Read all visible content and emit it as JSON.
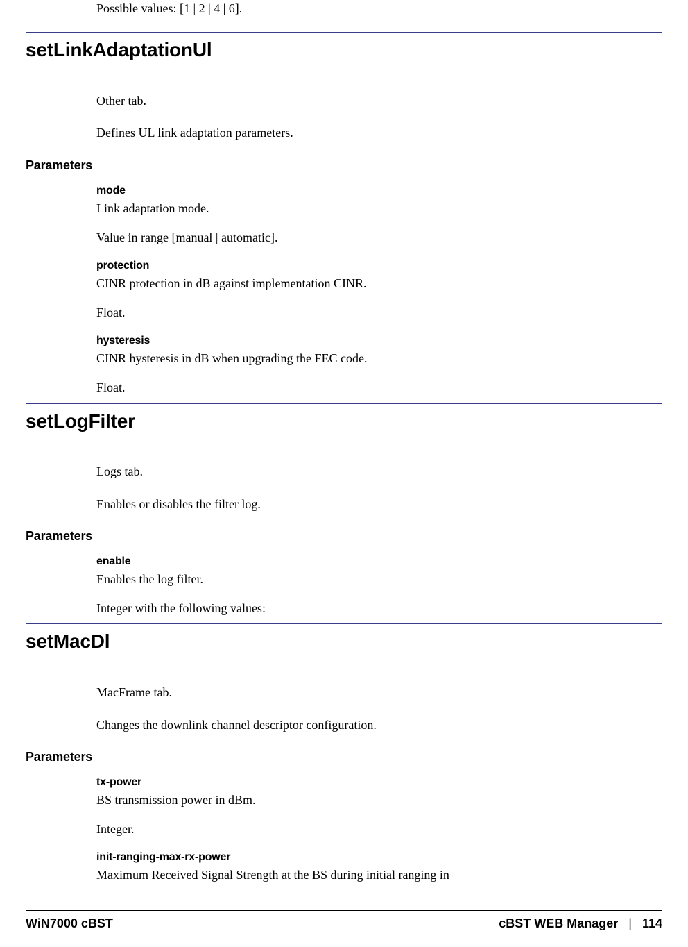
{
  "top_line": "Possible values: [1 | 2 | 4 | 6].",
  "sections": [
    {
      "heading": "setLinkAdaptationUl",
      "tab_line": "Other tab.",
      "desc_line": "Defines UL link adaptation parameters.",
      "params_label": "Parameters",
      "params": [
        {
          "name": "mode",
          "desc": "Link adaptation mode.",
          "type": "Value in range [manual | automatic]."
        },
        {
          "name": "protection",
          "desc": "CINR protection in dB against implementation CINR.",
          "type": "Float."
        },
        {
          "name": "hysteresis",
          "desc": "CINR hysteresis in dB when upgrading the FEC code.",
          "type": "Float."
        }
      ]
    },
    {
      "heading": "setLogFilter",
      "tab_line": "Logs tab.",
      "desc_line": "Enables or disables the filter log.",
      "params_label": "Parameters",
      "params": [
        {
          "name": "enable",
          "desc": "Enables the log filter.",
          "type": "Integer with the following values:"
        }
      ]
    },
    {
      "heading": "setMacDl",
      "tab_line": "MacFrame tab.",
      "desc_line": "Changes the downlink channel descriptor configuration.",
      "params_label": "Parameters",
      "params": [
        {
          "name": "tx-power",
          "desc": "BS transmission power in dBm.",
          "type": "Integer."
        },
        {
          "name": "init-ranging-max-rx-power",
          "desc": "Maximum Received Signal Strength at the BS during initial ranging in",
          "type": ""
        }
      ]
    }
  ],
  "footer": {
    "left": "WiN7000 cBST",
    "right_label": "cBST WEB Manager",
    "sep": "|",
    "page": "114"
  }
}
